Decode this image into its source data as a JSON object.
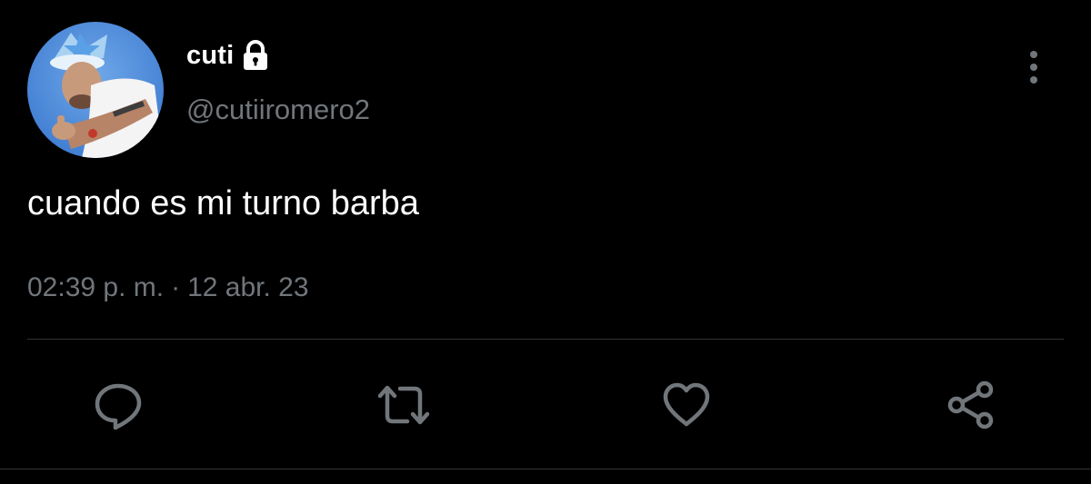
{
  "tweet": {
    "author": {
      "display_name": "cuti",
      "handle": "@cutiiromero2",
      "avatar_icon": "profile-photo",
      "protected_icon": "lock-icon"
    },
    "text": "cuando es mi turno barba",
    "time": "02:39 p. m.",
    "separator": "·",
    "date": "12 abr. 23"
  },
  "actions": [
    {
      "icon": "reply-icon"
    },
    {
      "icon": "retweet-icon"
    },
    {
      "icon": "like-icon"
    },
    {
      "icon": "share-icon"
    }
  ],
  "colors": {
    "background": "#000000",
    "primary_text": "#ffffff",
    "secondary_text": "#71767b",
    "divider": "#2f3336",
    "icon": "#71767b"
  }
}
